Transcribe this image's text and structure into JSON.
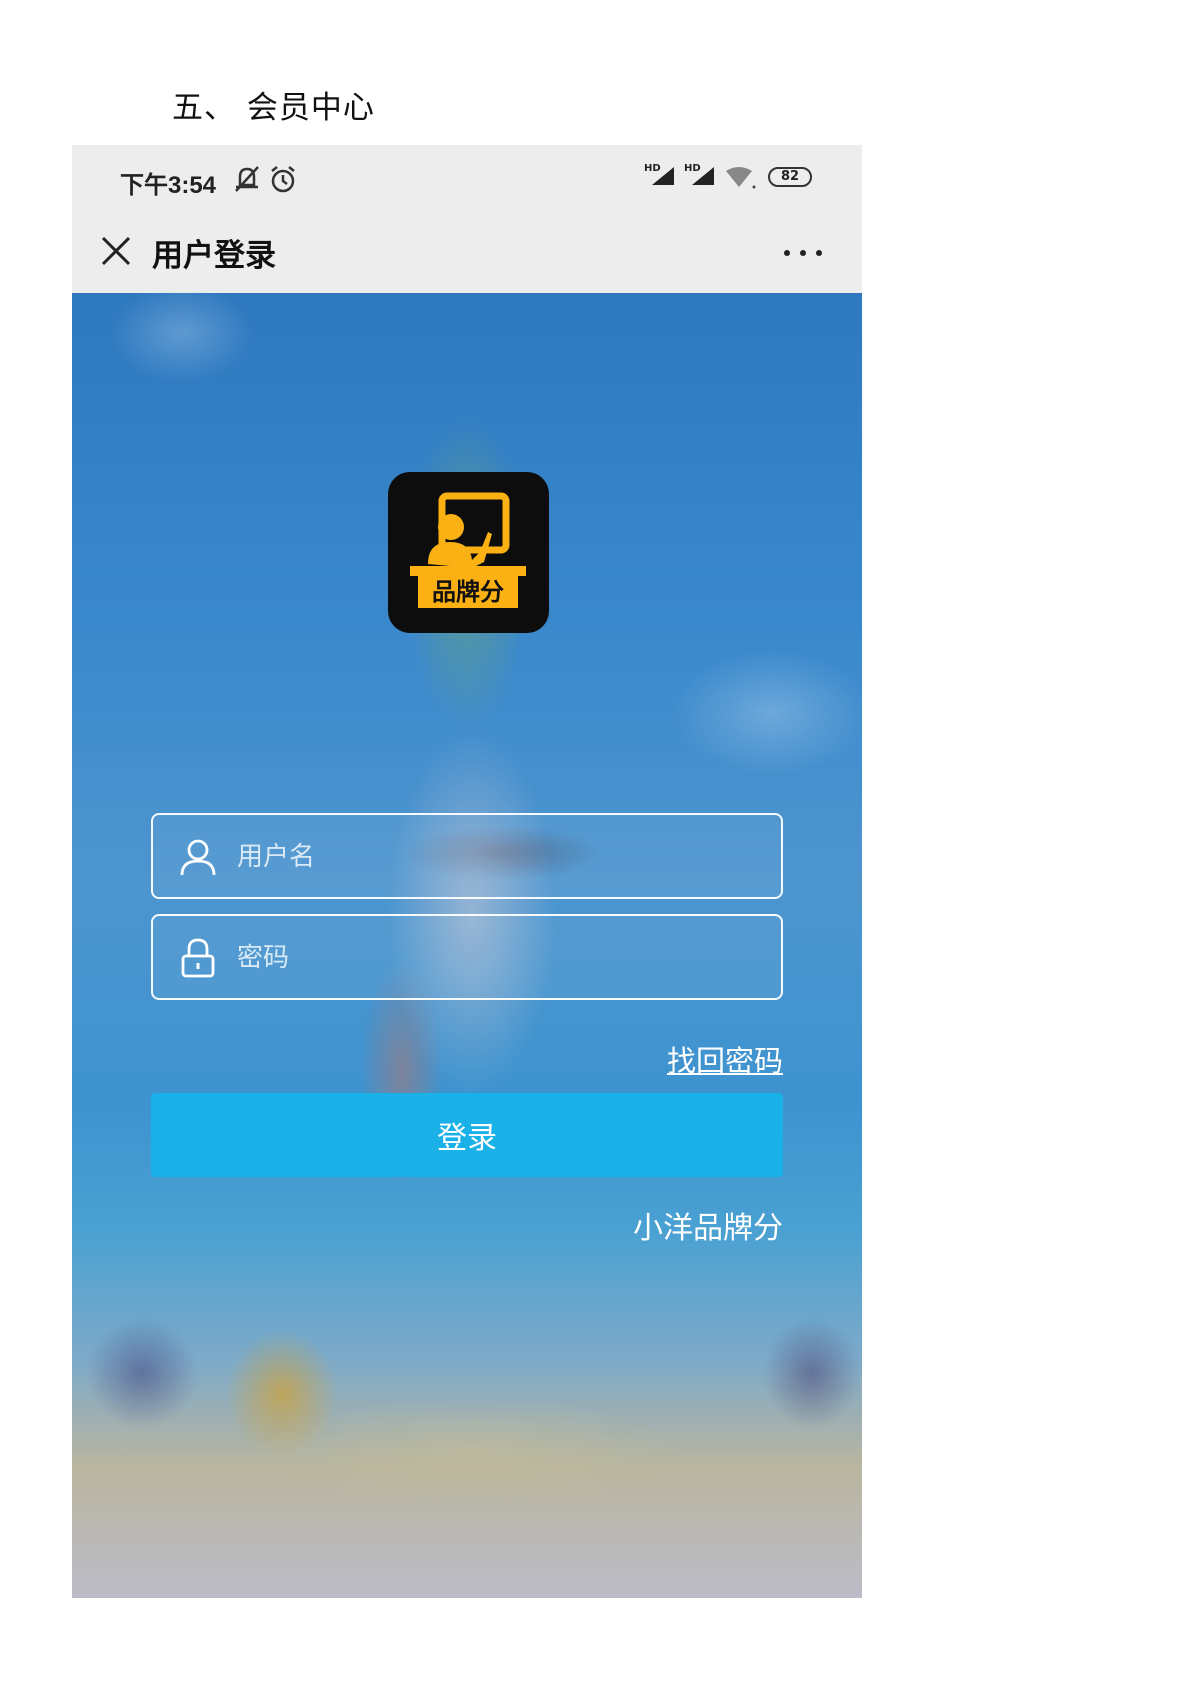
{
  "document": {
    "heading": "五、 会员中心"
  },
  "status_bar": {
    "time": "下午3:54",
    "signal1_label": "HD",
    "signal2_label": "HD",
    "battery": "82"
  },
  "nav": {
    "title": "用户登录"
  },
  "logo": {
    "text": "品牌分",
    "bg_color": "#0d0d0d",
    "accent_color": "#fbb113"
  },
  "form": {
    "username_placeholder": "用户名",
    "password_placeholder": "密码",
    "forgot_link": "找回密码",
    "login_button": "登录",
    "brand_label": "小洋品牌分"
  },
  "colors": {
    "primary_button": "#1ab0e8",
    "bar_bg": "#ededed"
  },
  "icons": [
    "close-icon",
    "more-icon",
    "user-icon",
    "lock-icon",
    "mute-icon",
    "alarm-icon",
    "signal-icon",
    "wifi-icon",
    "battery-icon"
  ]
}
